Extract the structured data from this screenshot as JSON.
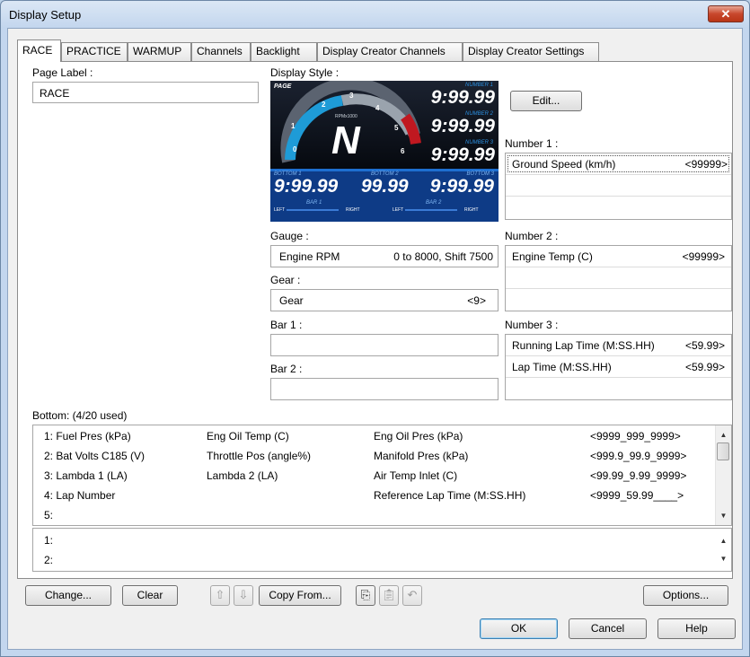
{
  "window": {
    "title": "Display Setup",
    "close_glyph": "✕"
  },
  "tabs": [
    {
      "label": "RACE"
    },
    {
      "label": "PRACTICE"
    },
    {
      "label": "WARMUP"
    },
    {
      "label": "Channels"
    },
    {
      "label": "Backlight"
    },
    {
      "label": "Display Creator Channels"
    },
    {
      "label": "Display Creator Settings"
    }
  ],
  "page_label": {
    "label": "Page Label :",
    "value": "RACE"
  },
  "display_style": {
    "label": "Display Style :",
    "edit_button": "Edit...",
    "preview": {
      "page": "PAGE",
      "rpm_label": "RPMx1000",
      "gear": "N",
      "dial_numbers": [
        "0",
        "1",
        "2",
        "3",
        "4",
        "5",
        "6"
      ],
      "number1_tag": "NUMBER 1",
      "number1_value": "9:99.99",
      "number2_tag": "NUMBER 2",
      "number2_value": "9:99.99",
      "number3_tag": "NUMBER 3",
      "number3_value": "9:99.99",
      "bottom1_tag": "BOTTOM 1",
      "bottom1_value": "9:99.99",
      "bottom2_tag": "BOTTOM 2",
      "bottom2_value": "99.99",
      "bottom3_tag": "BOTTOM 3",
      "bottom3_value": "9:99.99",
      "bar1_tag": "BAR 1",
      "bar2_tag": "BAR 2",
      "left": "LEFT",
      "right": "RIGHT"
    }
  },
  "gauge": {
    "label": "Gauge :",
    "name": "Engine RPM",
    "value": "0 to 8000, Shift 7500"
  },
  "gear": {
    "label": "Gear :",
    "name": "Gear",
    "value": "<9>"
  },
  "bar1": {
    "label": "Bar 1 :"
  },
  "bar2": {
    "label": "Bar 2 :"
  },
  "number1": {
    "label": "Number 1 :",
    "rows": [
      {
        "name": "Ground Speed (km/h)",
        "value": "<99999>"
      }
    ]
  },
  "number2": {
    "label": "Number 2 :",
    "rows": [
      {
        "name": "Engine Temp (C)",
        "value": "<99999>"
      }
    ]
  },
  "number3": {
    "label": "Number 3 :",
    "rows": [
      {
        "name": "Running Lap Time (M:SS.HH)",
        "value": "<59.99>"
      },
      {
        "name": "Lap Time (M:SS.HH)",
        "value": "<59.99>"
      }
    ]
  },
  "bottom": {
    "label": "Bottom: (4/20 used)",
    "rows": [
      {
        "c1": "1: Fuel Pres (kPa)",
        "c2": "Eng Oil Temp (C)",
        "c3": "Eng Oil Pres (kPa)",
        "c4": "<9999_999_9999>"
      },
      {
        "c1": "2: Bat Volts C185 (V)",
        "c2": "Throttle Pos (angle%)",
        "c3": "Manifold Pres (kPa)",
        "c4": "<999.9_99.9_9999>"
      },
      {
        "c1": "3: Lambda 1 (LA)",
        "c2": "Lambda 2 (LA)",
        "c3": "Air Temp Inlet (C)",
        "c4": "<99.99_9.99_9999>"
      },
      {
        "c1": "4: Lap Number",
        "c2": "",
        "c3": "Reference Lap Time (M:SS.HH)",
        "c4": "<9999_59.99____>"
      },
      {
        "c1": "5:",
        "c2": "",
        "c3": "",
        "c4": ""
      }
    ],
    "detail_rows": [
      {
        "c1": "1:"
      },
      {
        "c1": "2:"
      }
    ]
  },
  "toolbar": {
    "change": "Change...",
    "clear": "Clear",
    "copy_from": "Copy From...",
    "options": "Options..."
  },
  "dialog": {
    "ok": "OK",
    "cancel": "Cancel",
    "help": "Help"
  }
}
